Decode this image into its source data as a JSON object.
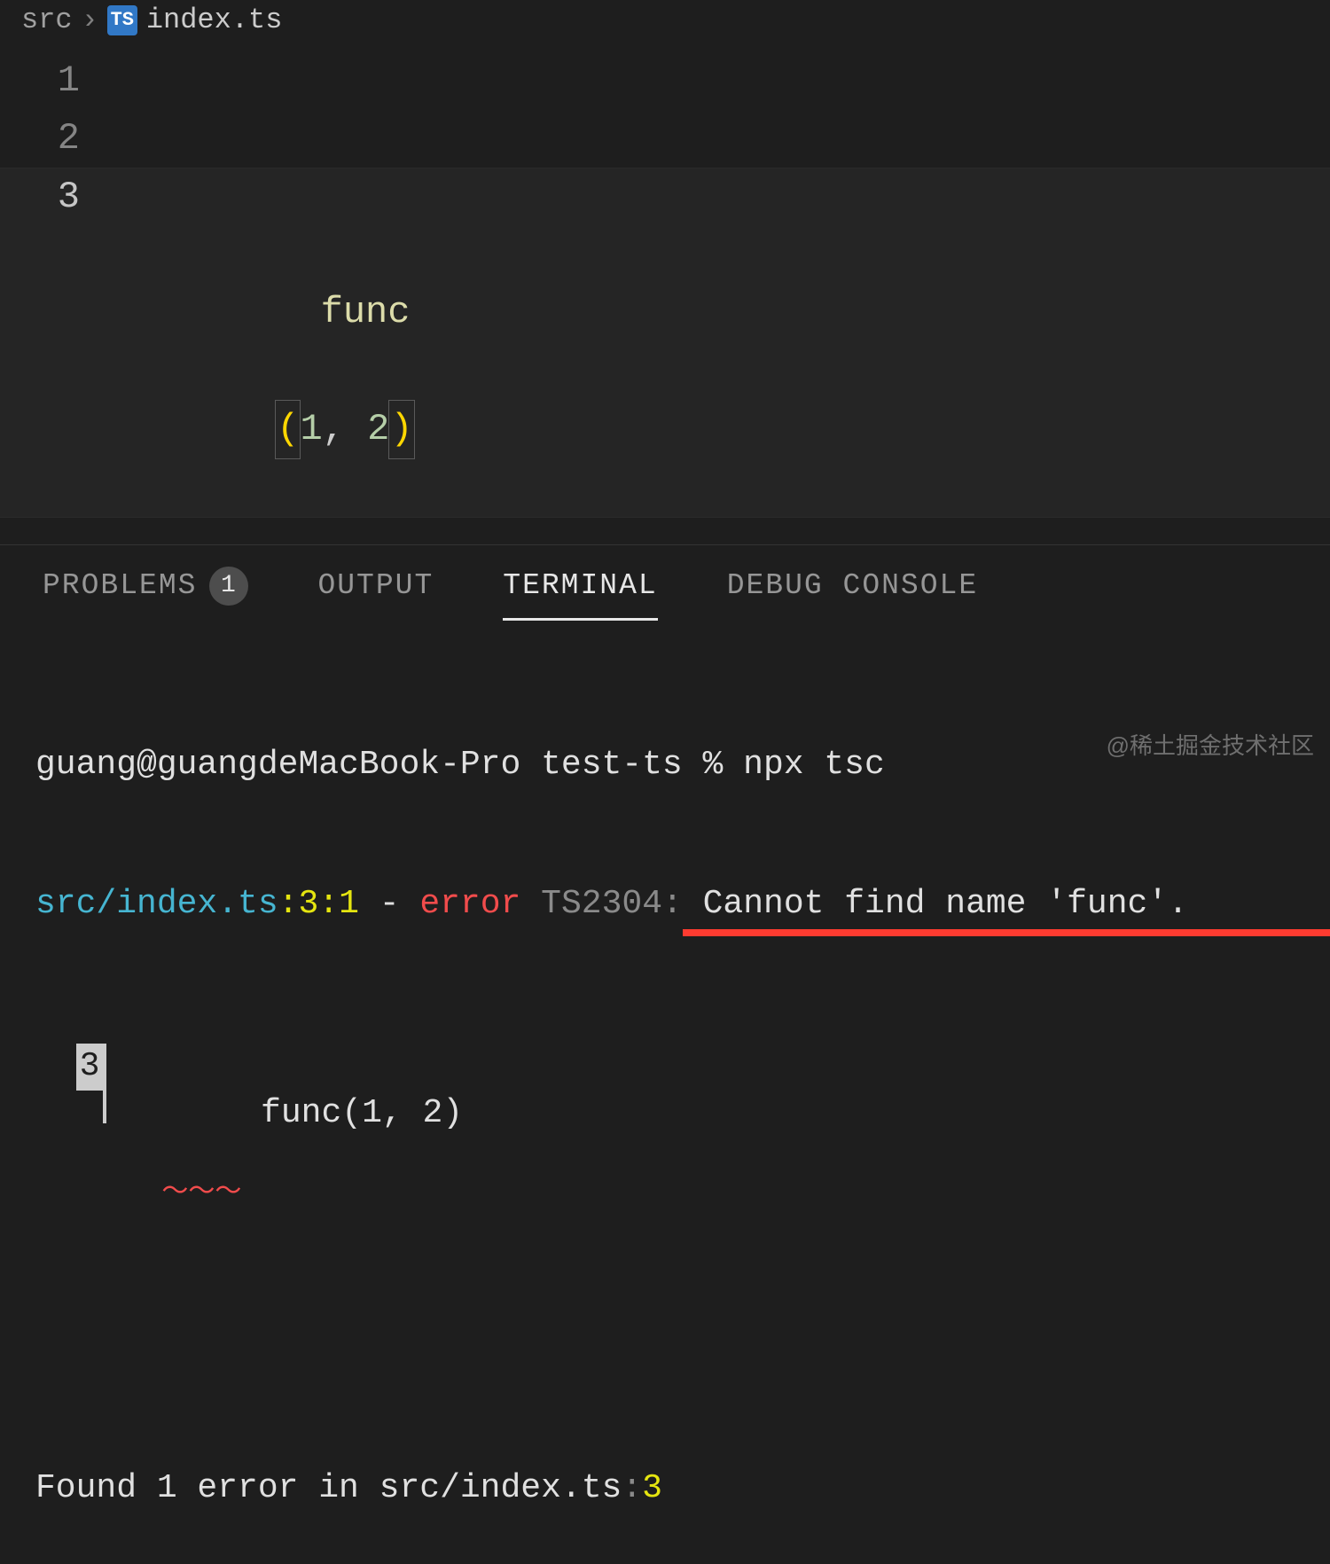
{
  "breadcrumb": {
    "folder": "src",
    "file": "index.ts",
    "fileIconText": "TS"
  },
  "editor": {
    "lines": [
      {
        "num": "1",
        "content": ""
      },
      {
        "num": "2",
        "content": ""
      }
    ],
    "activeLine": {
      "num": "3",
      "ident": "func",
      "lparen": "(",
      "arg1": "1",
      "comma": ", ",
      "arg2": "2",
      "rparen": ")"
    }
  },
  "panel": {
    "tabs": {
      "problems": "PROBLEMS",
      "problemsBadge": "1",
      "output": "OUTPUT",
      "terminal": "TERMINAL",
      "debug": "DEBUG CONSOLE"
    }
  },
  "terminal": {
    "prompt": "guang@guangdeMacBook-Pro test-ts % ",
    "cmd": "npx tsc",
    "errorLine": {
      "path": "src/index.ts",
      "sep1": ":",
      "line": "3",
      "sep2": ":",
      "col": "1",
      "dash": " - ",
      "errorLabel": "error",
      "space": " ",
      "code": "TS2304:",
      "msg": " Cannot find name 'func'."
    },
    "context": {
      "lineno": "3",
      "code": " func(1, 2)",
      "squiggle": "～～～"
    },
    "summary": "Found 1 error in src/index.ts",
    "summarySep": ":",
    "summaryLine": "3"
  },
  "watermark": "@稀土掘金技术社区"
}
